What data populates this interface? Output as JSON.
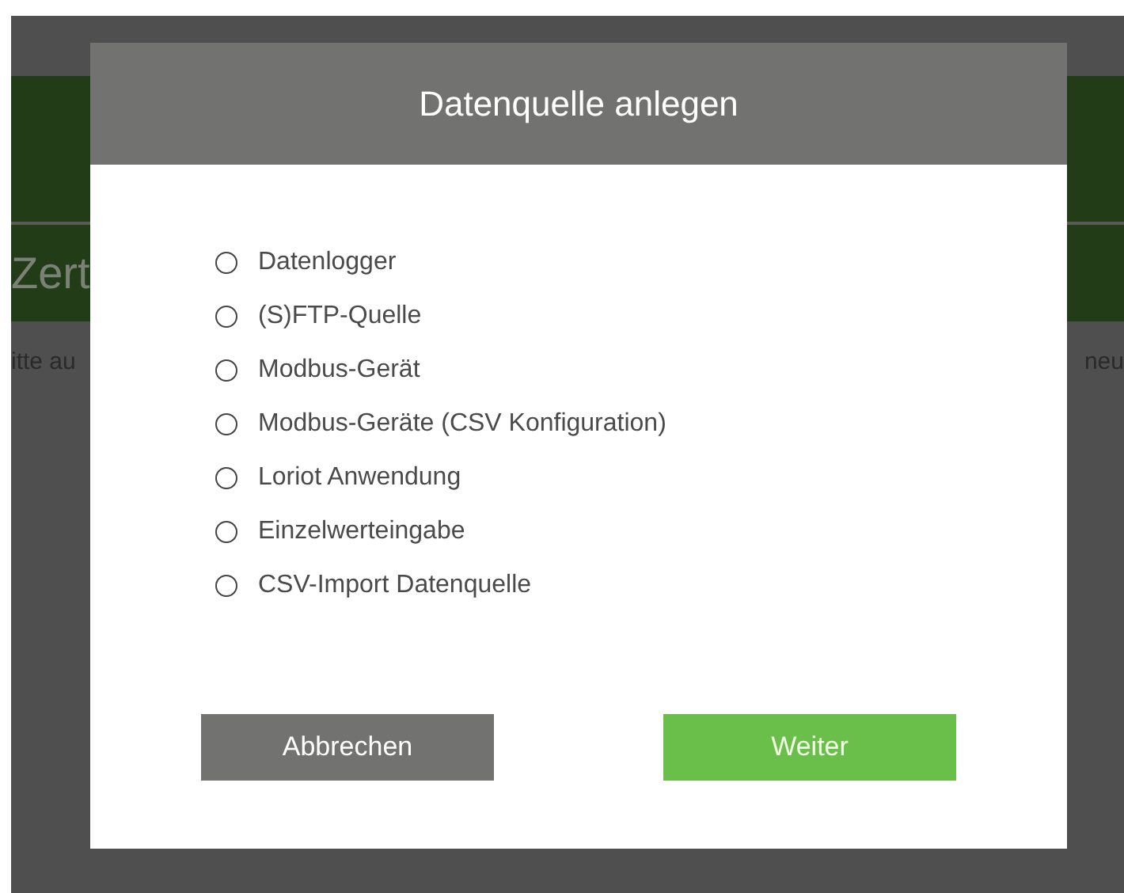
{
  "background_page": {
    "heading": "Zert",
    "text_left": "itte au",
    "text_right": "neu"
  },
  "dialog": {
    "title": "Datenquelle anlegen",
    "options": [
      {
        "label": "Datenlogger",
        "selected": false
      },
      {
        "label": "(S)FTP-Quelle",
        "selected": false
      },
      {
        "label": "Modbus-Gerät",
        "selected": false
      },
      {
        "label": "Modbus-Geräte (CSV Konfiguration)",
        "selected": false
      },
      {
        "label": "Loriot Anwendung",
        "selected": false
      },
      {
        "label": "Einzelwerteingabe",
        "selected": false
      },
      {
        "label": "CSV-Import Datenquelle",
        "selected": false
      }
    ],
    "buttons": [
      {
        "label": "Abbrechen",
        "kind": "secondary"
      },
      {
        "label": "Weiter",
        "kind": "primary"
      }
    ]
  }
}
